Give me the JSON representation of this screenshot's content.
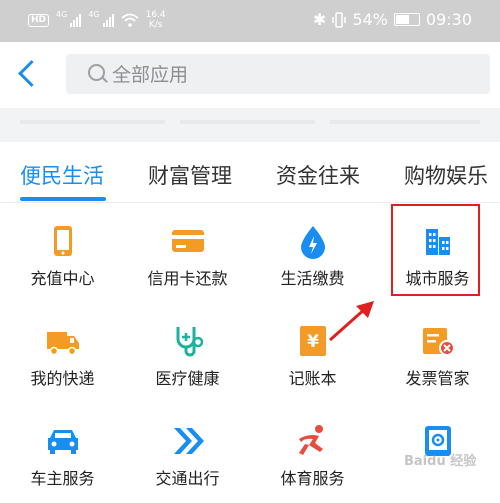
{
  "status_bar": {
    "hd": "HD",
    "net_a": "4G",
    "net_b": "4G",
    "speed_value": "16.4",
    "speed_unit": "K/s",
    "battery": "54%",
    "battery_level": 0.54,
    "time": "09:30"
  },
  "search": {
    "placeholder": "全部应用"
  },
  "tabs": [
    {
      "label": "便民生活",
      "active": true
    },
    {
      "label": "财富管理",
      "active": false
    },
    {
      "label": "资金往来",
      "active": false
    },
    {
      "label": "购物娱乐",
      "active": false
    }
  ],
  "apps": [
    {
      "label": "充值中心",
      "icon": "phone-icon"
    },
    {
      "label": "信用卡还款",
      "icon": "credit-card-icon"
    },
    {
      "label": "生活缴费",
      "icon": "water-drop-icon"
    },
    {
      "label": "城市服务",
      "icon": "city-buildings-icon"
    },
    {
      "label": "我的快递",
      "icon": "delivery-truck-icon"
    },
    {
      "label": "医疗健康",
      "icon": "stethoscope-icon"
    },
    {
      "label": "记账本",
      "icon": "yen-ledger-icon"
    },
    {
      "label": "发票管家",
      "icon": "invoice-icon"
    },
    {
      "label": "车主服务",
      "icon": "car-icon"
    },
    {
      "label": "交通出行",
      "icon": "double-chevron-icon"
    },
    {
      "label": "体育服务",
      "icon": "sports-figure-icon"
    },
    {
      "label": "",
      "icon": "safe-icon"
    }
  ],
  "colors": {
    "accent_blue": "#1a8ef0",
    "orange": "#f39b26",
    "teal": "#1bb39b",
    "red": "#e84c3d",
    "highlight_red": "#e02020"
  },
  "watermark": "Baidu 经验"
}
